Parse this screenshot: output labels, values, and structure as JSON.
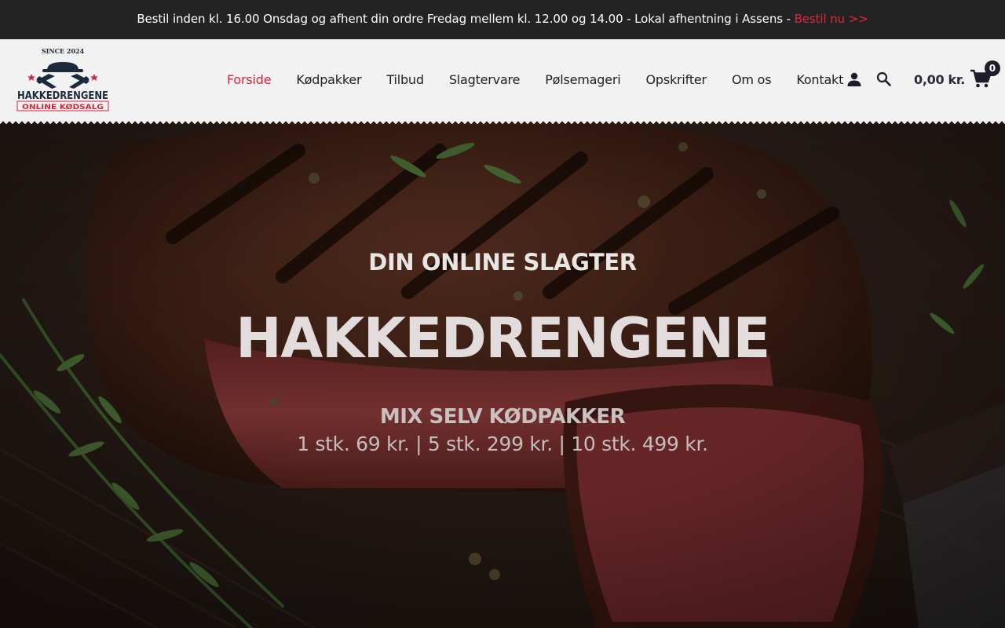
{
  "announcement": {
    "text": "Bestil inden kl. 16.00 Onsdag og afhent din ordre Fredag mellem kl. 12.00 og 14.00 - Lokal afhentning i Assens - ",
    "cta": "Bestil nu >>"
  },
  "logo": {
    "since": "SINCE 2024",
    "brand": "HAKKEDRENGENE",
    "tagline": "ONLINE KØDSALG"
  },
  "nav": [
    {
      "label": "Forside",
      "active": true
    },
    {
      "label": "Kødpakker"
    },
    {
      "label": "Tilbud"
    },
    {
      "label": "Slagtervare"
    },
    {
      "label": "Pølsemageri"
    },
    {
      "label": "Opskrifter"
    },
    {
      "label": "Om os"
    },
    {
      "label": "Kontakt"
    }
  ],
  "header_icons": {
    "account": "user-icon",
    "search": "search-icon",
    "cart": "cart-icon"
  },
  "cart": {
    "total": "0,00 kr.",
    "count": "0"
  },
  "hero": {
    "eyebrow": "DIN ONLINE SLAGTER",
    "title": "HAKKEDRENGENE",
    "subtitle": "MIX SELV KØDPAKKER",
    "prices": "1 stk. 69 kr. | 5 stk. 299 kr. | 10 stk. 499 kr."
  },
  "colors": {
    "accent": "#d72238",
    "topbar": "#232323",
    "header": "#f2f2f2",
    "navy": "#1d1d2b"
  }
}
